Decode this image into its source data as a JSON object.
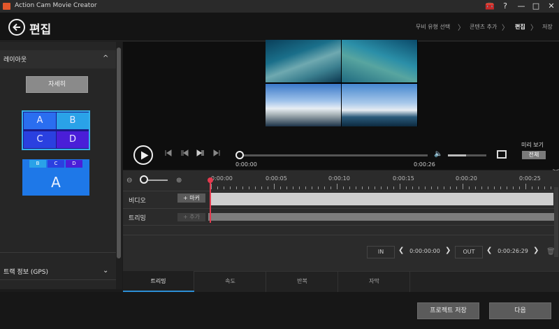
{
  "window": {
    "title": "Action Cam Movie Creator",
    "controls": {
      "toolbox": "🧰",
      "help": "?",
      "minimize": "—",
      "maximize": "□",
      "close": "✕"
    }
  },
  "header": {
    "title": "편집",
    "breadcrumb": [
      "무비 유형 선택",
      "콘텐츠 추가",
      "편집",
      "저장"
    ],
    "breadcrumb_sep": "〉",
    "active_index": 2
  },
  "left_panel": {
    "layout_section": {
      "label": "레이아웃",
      "detail_button": "자세히",
      "chevron": "^"
    },
    "layout_quad": [
      "A",
      "B",
      "C",
      "D"
    ],
    "layout_tall": {
      "small": [
        "B",
        "C",
        "D"
      ],
      "big": "A"
    },
    "gps_section": {
      "label": "트랙 정보 (GPS)",
      "chevron": "⌄"
    }
  },
  "player": {
    "current_time": "0:00:00",
    "end_time": "0:00:26",
    "volume_level": 0.47,
    "preview_label": "미리 보기",
    "preview_all_button": "전체"
  },
  "timeline": {
    "tick_labels": [
      "0:00:00",
      "0:00:05",
      "0:00:10",
      "0:00:15",
      "0:00:20",
      "0:00:25"
    ],
    "tracks": [
      {
        "label": "비디오",
        "button": "+ 마커"
      },
      {
        "label": "트리밍",
        "button": "+ 추가"
      }
    ],
    "in": {
      "label": "IN",
      "time": "0:00:00:00"
    },
    "out": {
      "label": "OUT",
      "time": "0:00:26:29"
    }
  },
  "tabs": [
    "트리밍",
    "속도",
    "반복",
    "자막"
  ],
  "footer": {
    "save_project": "프로젝트 저장",
    "next": "다음"
  },
  "colors": {
    "accent": "#2c8fd6",
    "playhead": "#e43a4e",
    "layout_selected": "#35b0ea"
  }
}
